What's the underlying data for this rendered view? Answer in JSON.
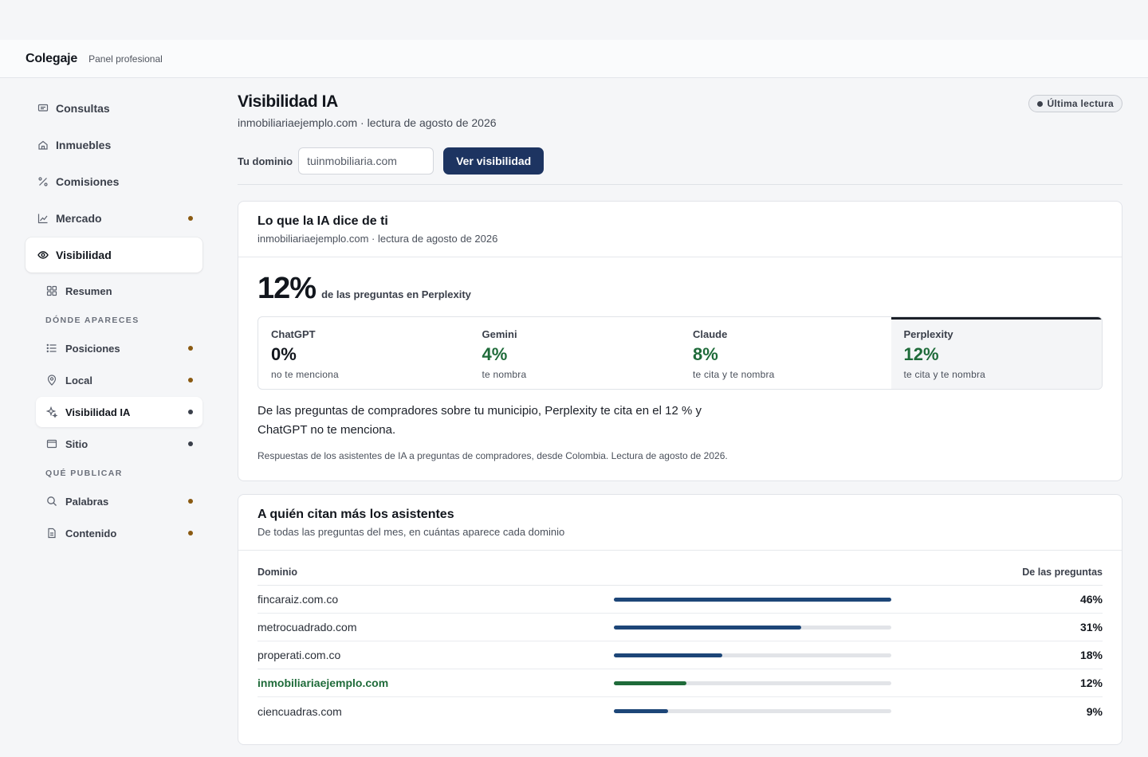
{
  "header": {
    "brand": "Colegaje",
    "subtitle": "Panel profesional"
  },
  "sidebar": {
    "items": [
      {
        "label": "Consultas",
        "icon": "message-icon",
        "dot": false
      },
      {
        "label": "Inmuebles",
        "icon": "home-icon",
        "dot": false
      },
      {
        "label": "Comisiones",
        "icon": "percent-icon",
        "dot": false
      },
      {
        "label": "Mercado",
        "icon": "chart-icon",
        "dot": true
      },
      {
        "label": "Visibilidad",
        "icon": "eye-icon",
        "dot": false,
        "active": true
      }
    ],
    "resumen": "Resumen",
    "section_donde": "DÓNDE APARECES",
    "donde_items": [
      {
        "label": "Posiciones",
        "icon": "list-icon"
      },
      {
        "label": "Local",
        "icon": "pin-icon"
      },
      {
        "label": "Visibilidad IA",
        "icon": "sparkle-icon",
        "active": true
      },
      {
        "label": "Sitio",
        "icon": "window-icon"
      }
    ],
    "section_publicar": "QUÉ PUBLICAR",
    "publicar_items": [
      {
        "label": "Palabras",
        "icon": "search-icon"
      },
      {
        "label": "Contenido",
        "icon": "document-icon"
      }
    ],
    "dot_color": "#8a5a12"
  },
  "main": {
    "title": "Visibilidad IA",
    "subtitle": "inmobiliariaejemplo.com · lectura de agosto de 2026",
    "status_pill": "Última lectura",
    "domain_label": "Tu dominio",
    "domain_placeholder": "tuinmobiliaria.com",
    "button_label": "Ver visibilidad",
    "accent_color": "#1d3461"
  },
  "card_ia": {
    "title": "Lo que la IA dice de ti",
    "subtitle": "inmobiliariaejemplo.com · lectura de agosto de 2026",
    "big_value": "12%",
    "big_caption": "de las preguntas en Perplexity",
    "assistants": [
      {
        "name": "ChatGPT",
        "pct": "0%",
        "note": "no te menciona"
      },
      {
        "name": "Gemini",
        "pct": "4%",
        "note": "te nombra"
      },
      {
        "name": "Claude",
        "pct": "8%",
        "note": "te cita y te nombra"
      },
      {
        "name": "Perplexity",
        "pct": "12%",
        "note": "te cita y te nombra"
      }
    ],
    "summary": "De las preguntas de compradores sobre tu municipio, Perplexity te cita en el 12 % y ChatGPT no te menciona.",
    "footnote": "Respuestas de los asistentes de IA a preguntas de compradores, desde Colombia. Lectura de agosto de 2026.",
    "positive_color": "#1f6b3a"
  },
  "card_citas": {
    "title": "A quién citan más los asistentes",
    "subtitle": "De todas las preguntas del mes, en cuántas aparece cada dominio",
    "col_domain": "Dominio",
    "col_share": "De las preguntas",
    "rows": [
      {
        "domain": "fincaraiz.com.co",
        "share": 46,
        "label": "46%"
      },
      {
        "domain": "metrocuadrado.com",
        "share": 31,
        "label": "31%"
      },
      {
        "domain": "properati.com.co",
        "share": 18,
        "label": "18%"
      },
      {
        "domain": "inmobiliariaejemplo.com",
        "share": 12,
        "label": "12%",
        "own": true
      },
      {
        "domain": "ciencuadras.com",
        "share": 9,
        "label": "9%"
      }
    ],
    "bar_color": "#1d4678",
    "bar_max_pct": 46
  }
}
